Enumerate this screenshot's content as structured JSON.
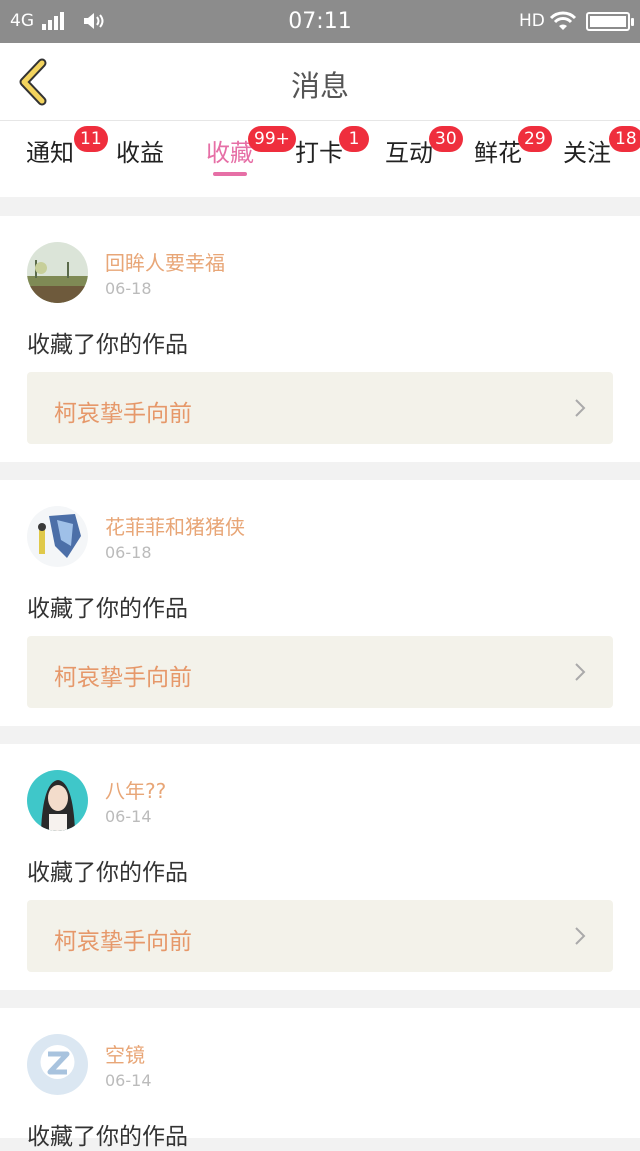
{
  "status_bar": {
    "network": "4G",
    "time": "07:11",
    "hd": "HD"
  },
  "header": {
    "title": "消息",
    "icons": {
      "back": "chevron-left-icon"
    }
  },
  "tabs": [
    {
      "label": "通知",
      "badge": "11",
      "active": false
    },
    {
      "label": "收益",
      "badge": "",
      "active": false
    },
    {
      "label": "收藏",
      "badge": "99+",
      "active": true
    },
    {
      "label": "打卡",
      "badge": "1",
      "active": false
    },
    {
      "label": "互动",
      "badge": "30",
      "active": false
    },
    {
      "label": "鲜花",
      "badge": "29",
      "active": false
    },
    {
      "label": "关注",
      "badge": "18",
      "active": false
    }
  ],
  "colors": {
    "accent": "#e66fa6",
    "badge": "#ef2e3d",
    "username": "#e8a677",
    "work_title": "#e6986a",
    "work_bg": "#f3f2ea"
  },
  "messages": [
    {
      "username": "回眸人要幸福",
      "date": "06-18",
      "action": "收藏了你的作品",
      "work_title": "柯哀挚手向前",
      "avatar": "landscape-avatar"
    },
    {
      "username": "花菲菲和猪猪侠",
      "date": "06-18",
      "action": "收藏了你的作品",
      "work_title": "柯哀挚手向前",
      "avatar": "illustration-avatar"
    },
    {
      "username": "八年??",
      "date": "06-14",
      "action": "收藏了你的作品",
      "work_title": "柯哀挚手向前",
      "avatar": "portrait-avatar"
    },
    {
      "username": "空镜",
      "date": "06-14",
      "action": "收藏了你的作品",
      "work_title": "",
      "avatar": "default-avatar"
    }
  ]
}
